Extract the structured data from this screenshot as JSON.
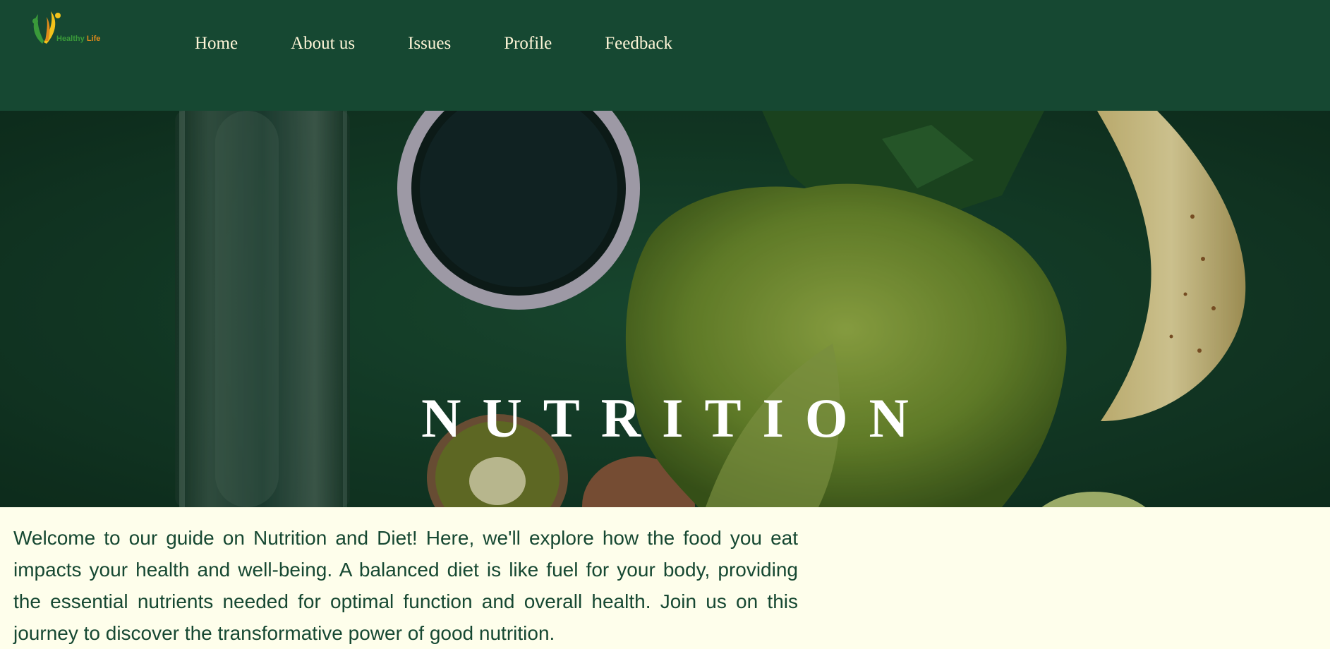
{
  "brand": {
    "logo_word1": "Healthy",
    "logo_word2": "Life",
    "colors": {
      "header": "#164832",
      "page": "#fefeeb",
      "nav_text": "#fff6d8",
      "body_text": "#164832"
    }
  },
  "nav": {
    "items": [
      {
        "label": "Home"
      },
      {
        "label": "About us"
      },
      {
        "label": "Issues"
      },
      {
        "label": "Profile"
      },
      {
        "label": "Feedback"
      }
    ]
  },
  "hero": {
    "title": "NUTRITION",
    "image": "healthy-foods-background"
  },
  "intro": {
    "text": "Welcome to our guide on Nutrition and Diet! Here, we'll explore how the food you eat impacts your health and well-being. A balanced diet is like fuel for your body, providing the essential nutrients needed for optimal function and overall health. Join us on this journey to discover the transformative power of good nutrition."
  }
}
